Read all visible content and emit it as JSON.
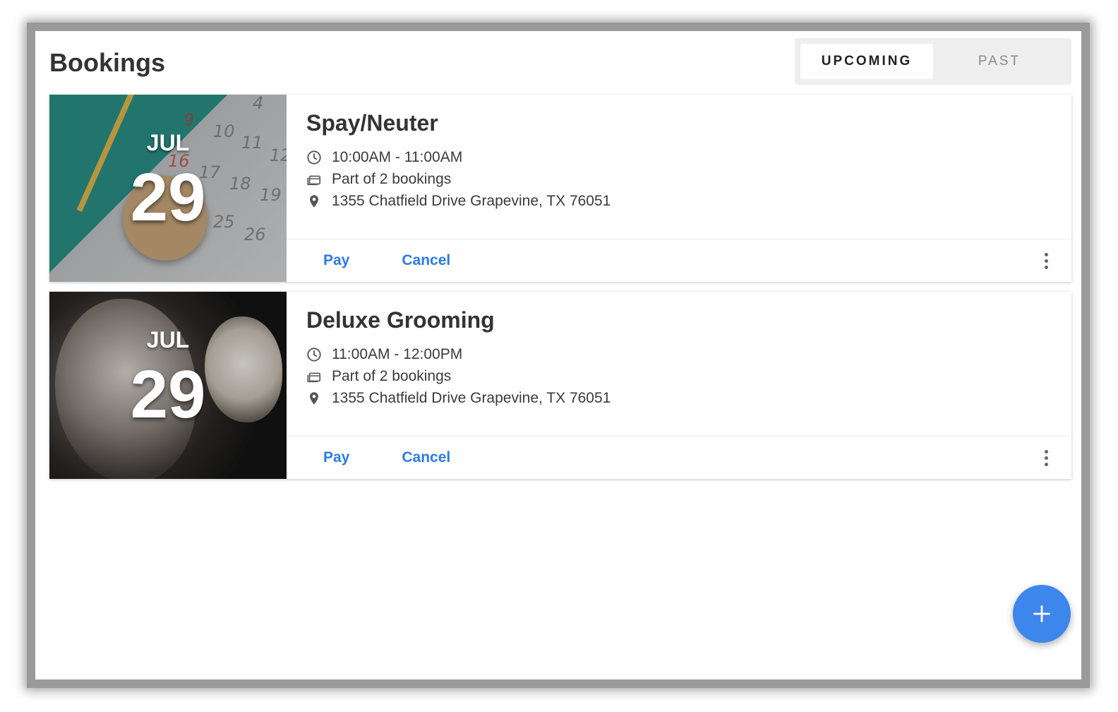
{
  "page": {
    "title": "Bookings"
  },
  "tabs": [
    {
      "label": "UPCOMING",
      "active": true
    },
    {
      "label": "PAST",
      "active": false
    }
  ],
  "bookings": [
    {
      "month": "JUL",
      "day": "29",
      "title": "Spay/Neuter",
      "time": "10:00AM - 11:00AM",
      "group": "Part of 2 bookings",
      "address": "1355 Chatfield Drive Grapevine, TX 76051",
      "pay_label": "Pay",
      "cancel_label": "Cancel",
      "image": "calendar-clock-photo"
    },
    {
      "month": "JUL",
      "day": "29",
      "title": "Deluxe Grooming",
      "time": "11:00AM - 12:00PM",
      "group": "Part of 2 bookings",
      "address": "1355 Chatfield Drive Grapevine, TX 76051",
      "pay_label": "Pay",
      "cancel_label": "Cancel",
      "image": "dogs-photo"
    }
  ],
  "icons": {
    "time": "clock-icon",
    "group": "bookings-stack-icon",
    "address": "location-pin-icon",
    "more": "more-vertical-icon",
    "fab": "plus-icon"
  },
  "colors": {
    "accent": "#2d7be5",
    "fab": "#3d86ec",
    "tab_bg": "#eeeeee"
  }
}
